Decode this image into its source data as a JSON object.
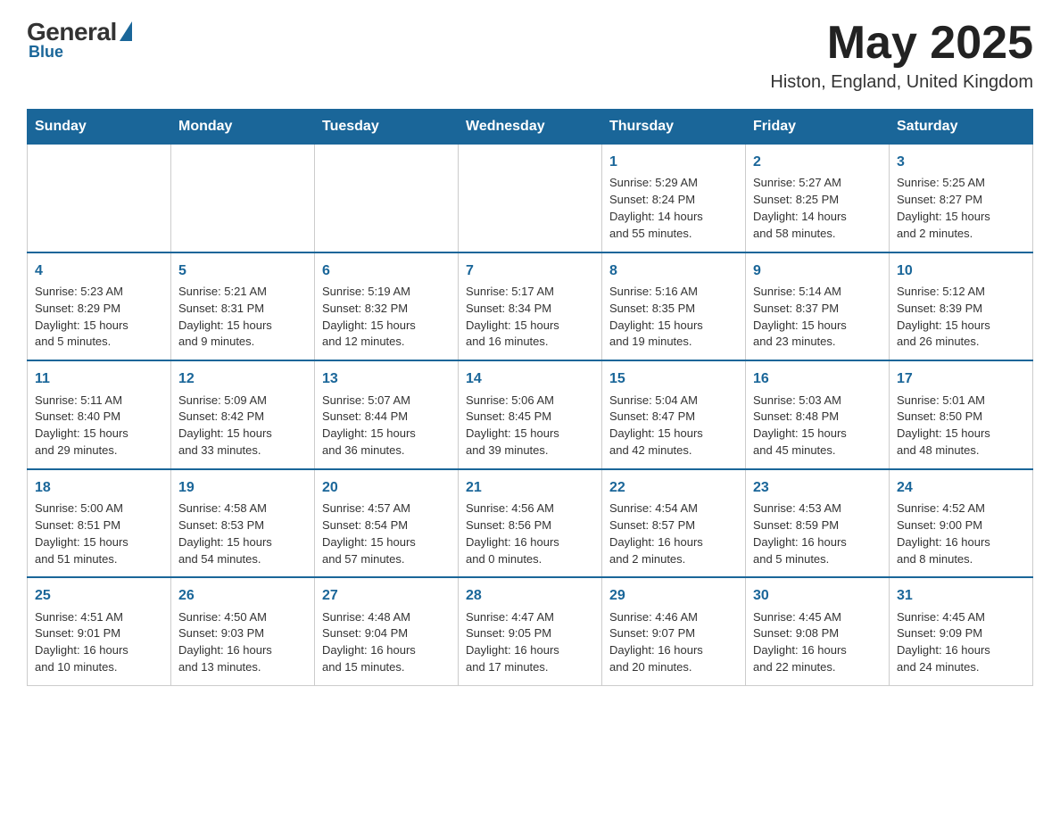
{
  "logo": {
    "general": "General",
    "blue": "Blue",
    "underline": "Blue"
  },
  "header": {
    "title": "May 2025",
    "subtitle": "Histon, England, United Kingdom"
  },
  "days_of_week": [
    "Sunday",
    "Monday",
    "Tuesday",
    "Wednesday",
    "Thursday",
    "Friday",
    "Saturday"
  ],
  "weeks": [
    [
      {
        "day": "",
        "info": ""
      },
      {
        "day": "",
        "info": ""
      },
      {
        "day": "",
        "info": ""
      },
      {
        "day": "",
        "info": ""
      },
      {
        "day": "1",
        "info": "Sunrise: 5:29 AM\nSunset: 8:24 PM\nDaylight: 14 hours\nand 55 minutes."
      },
      {
        "day": "2",
        "info": "Sunrise: 5:27 AM\nSunset: 8:25 PM\nDaylight: 14 hours\nand 58 minutes."
      },
      {
        "day": "3",
        "info": "Sunrise: 5:25 AM\nSunset: 8:27 PM\nDaylight: 15 hours\nand 2 minutes."
      }
    ],
    [
      {
        "day": "4",
        "info": "Sunrise: 5:23 AM\nSunset: 8:29 PM\nDaylight: 15 hours\nand 5 minutes."
      },
      {
        "day": "5",
        "info": "Sunrise: 5:21 AM\nSunset: 8:31 PM\nDaylight: 15 hours\nand 9 minutes."
      },
      {
        "day": "6",
        "info": "Sunrise: 5:19 AM\nSunset: 8:32 PM\nDaylight: 15 hours\nand 12 minutes."
      },
      {
        "day": "7",
        "info": "Sunrise: 5:17 AM\nSunset: 8:34 PM\nDaylight: 15 hours\nand 16 minutes."
      },
      {
        "day": "8",
        "info": "Sunrise: 5:16 AM\nSunset: 8:35 PM\nDaylight: 15 hours\nand 19 minutes."
      },
      {
        "day": "9",
        "info": "Sunrise: 5:14 AM\nSunset: 8:37 PM\nDaylight: 15 hours\nand 23 minutes."
      },
      {
        "day": "10",
        "info": "Sunrise: 5:12 AM\nSunset: 8:39 PM\nDaylight: 15 hours\nand 26 minutes."
      }
    ],
    [
      {
        "day": "11",
        "info": "Sunrise: 5:11 AM\nSunset: 8:40 PM\nDaylight: 15 hours\nand 29 minutes."
      },
      {
        "day": "12",
        "info": "Sunrise: 5:09 AM\nSunset: 8:42 PM\nDaylight: 15 hours\nand 33 minutes."
      },
      {
        "day": "13",
        "info": "Sunrise: 5:07 AM\nSunset: 8:44 PM\nDaylight: 15 hours\nand 36 minutes."
      },
      {
        "day": "14",
        "info": "Sunrise: 5:06 AM\nSunset: 8:45 PM\nDaylight: 15 hours\nand 39 minutes."
      },
      {
        "day": "15",
        "info": "Sunrise: 5:04 AM\nSunset: 8:47 PM\nDaylight: 15 hours\nand 42 minutes."
      },
      {
        "day": "16",
        "info": "Sunrise: 5:03 AM\nSunset: 8:48 PM\nDaylight: 15 hours\nand 45 minutes."
      },
      {
        "day": "17",
        "info": "Sunrise: 5:01 AM\nSunset: 8:50 PM\nDaylight: 15 hours\nand 48 minutes."
      }
    ],
    [
      {
        "day": "18",
        "info": "Sunrise: 5:00 AM\nSunset: 8:51 PM\nDaylight: 15 hours\nand 51 minutes."
      },
      {
        "day": "19",
        "info": "Sunrise: 4:58 AM\nSunset: 8:53 PM\nDaylight: 15 hours\nand 54 minutes."
      },
      {
        "day": "20",
        "info": "Sunrise: 4:57 AM\nSunset: 8:54 PM\nDaylight: 15 hours\nand 57 minutes."
      },
      {
        "day": "21",
        "info": "Sunrise: 4:56 AM\nSunset: 8:56 PM\nDaylight: 16 hours\nand 0 minutes."
      },
      {
        "day": "22",
        "info": "Sunrise: 4:54 AM\nSunset: 8:57 PM\nDaylight: 16 hours\nand 2 minutes."
      },
      {
        "day": "23",
        "info": "Sunrise: 4:53 AM\nSunset: 8:59 PM\nDaylight: 16 hours\nand 5 minutes."
      },
      {
        "day": "24",
        "info": "Sunrise: 4:52 AM\nSunset: 9:00 PM\nDaylight: 16 hours\nand 8 minutes."
      }
    ],
    [
      {
        "day": "25",
        "info": "Sunrise: 4:51 AM\nSunset: 9:01 PM\nDaylight: 16 hours\nand 10 minutes."
      },
      {
        "day": "26",
        "info": "Sunrise: 4:50 AM\nSunset: 9:03 PM\nDaylight: 16 hours\nand 13 minutes."
      },
      {
        "day": "27",
        "info": "Sunrise: 4:48 AM\nSunset: 9:04 PM\nDaylight: 16 hours\nand 15 minutes."
      },
      {
        "day": "28",
        "info": "Sunrise: 4:47 AM\nSunset: 9:05 PM\nDaylight: 16 hours\nand 17 minutes."
      },
      {
        "day": "29",
        "info": "Sunrise: 4:46 AM\nSunset: 9:07 PM\nDaylight: 16 hours\nand 20 minutes."
      },
      {
        "day": "30",
        "info": "Sunrise: 4:45 AM\nSunset: 9:08 PM\nDaylight: 16 hours\nand 22 minutes."
      },
      {
        "day": "31",
        "info": "Sunrise: 4:45 AM\nSunset: 9:09 PM\nDaylight: 16 hours\nand 24 minutes."
      }
    ]
  ]
}
